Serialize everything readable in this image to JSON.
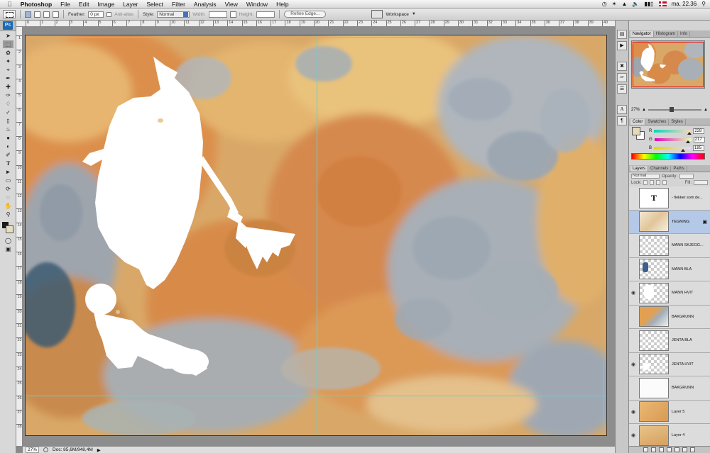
{
  "menubar": {
    "app": "Photoshop",
    "items": [
      "File",
      "Edit",
      "Image",
      "Layer",
      "Select",
      "Filter",
      "Analysis",
      "View",
      "Window",
      "Help"
    ],
    "clock": "ma. 22.36"
  },
  "options": {
    "feather_label": "Feather:",
    "feather_value": "0 px",
    "antialias_label": "Anti-alias",
    "style_label": "Style:",
    "style_value": "Normal",
    "width_label": "Width:",
    "height_label": "Height:",
    "refine_label": "Refine Edge...",
    "workspace_label": "Workspace"
  },
  "ruler": {
    "top": [
      "0",
      "1",
      "2",
      "3",
      "4",
      "5",
      "6",
      "7",
      "8",
      "9",
      "10",
      "11",
      "12",
      "13",
      "14",
      "15",
      "16",
      "17",
      "18",
      "19",
      "20",
      "21",
      "22",
      "23",
      "24",
      "25",
      "26",
      "27",
      "28",
      "29",
      "30",
      "31",
      "32",
      "33",
      "34",
      "35",
      "36",
      "37",
      "38",
      "39",
      "40"
    ],
    "left": [
      "1",
      "2",
      "3",
      "4",
      "5",
      "6",
      "7",
      "8",
      "9",
      "10",
      "11",
      "12",
      "13",
      "14",
      "15",
      "16",
      "17",
      "18",
      "19",
      "20",
      "21",
      "22",
      "23",
      "24",
      "25",
      "26",
      "27",
      "28"
    ]
  },
  "status": {
    "zoom": "27%",
    "doc": "Doc: 85,6M/948,4M"
  },
  "navigator": {
    "tabs": [
      "Navigator",
      "Histogram",
      "Info"
    ],
    "zoom": "27%"
  },
  "color_panel": {
    "tabs": [
      "Color",
      "Swatches",
      "Styles"
    ],
    "channels": [
      {
        "label": "R",
        "value": "228",
        "level": 0.89
      },
      {
        "label": "G",
        "value": "217",
        "level": 0.85
      },
      {
        "label": "B",
        "value": "185",
        "level": 0.73
      }
    ],
    "foreground": "#e4d9b9"
  },
  "layers_panel": {
    "tabs": [
      "Layers",
      "Channels",
      "Paths"
    ],
    "blend": "Normal",
    "opacity_label": "Opacity:",
    "lock_label": "Lock:",
    "fill_label": "Fill:",
    "layers": [
      {
        "name": "- flekker som de...",
        "type": "text",
        "visible": false,
        "thumb": "text"
      },
      {
        "name": "TEGNING",
        "visible": false,
        "selected": true,
        "linked": true,
        "thumb": "drawing"
      },
      {
        "name": "MANN SKJEGG...",
        "visible": false,
        "thumb": "trans"
      },
      {
        "name": "MANN BLÅ",
        "visible": false,
        "thumb": "blue-spot"
      },
      {
        "name": "MANN HVIT",
        "visible": true,
        "thumb": "white-shape"
      },
      {
        "name": "BAKGRUNN",
        "visible": false,
        "thumb": "orange-blue"
      },
      {
        "name": "JENTA BLÅ",
        "visible": false,
        "thumb": "trans"
      },
      {
        "name": "JENTA HVIT",
        "visible": true,
        "thumb": "trans-white"
      },
      {
        "name": "BAKGRUNN",
        "visible": false,
        "thumb": "white"
      },
      {
        "name": "Layer 5",
        "visible": true,
        "thumb": "orange"
      },
      {
        "name": "Layer 4",
        "visible": true,
        "thumb": "orange2"
      }
    ]
  }
}
